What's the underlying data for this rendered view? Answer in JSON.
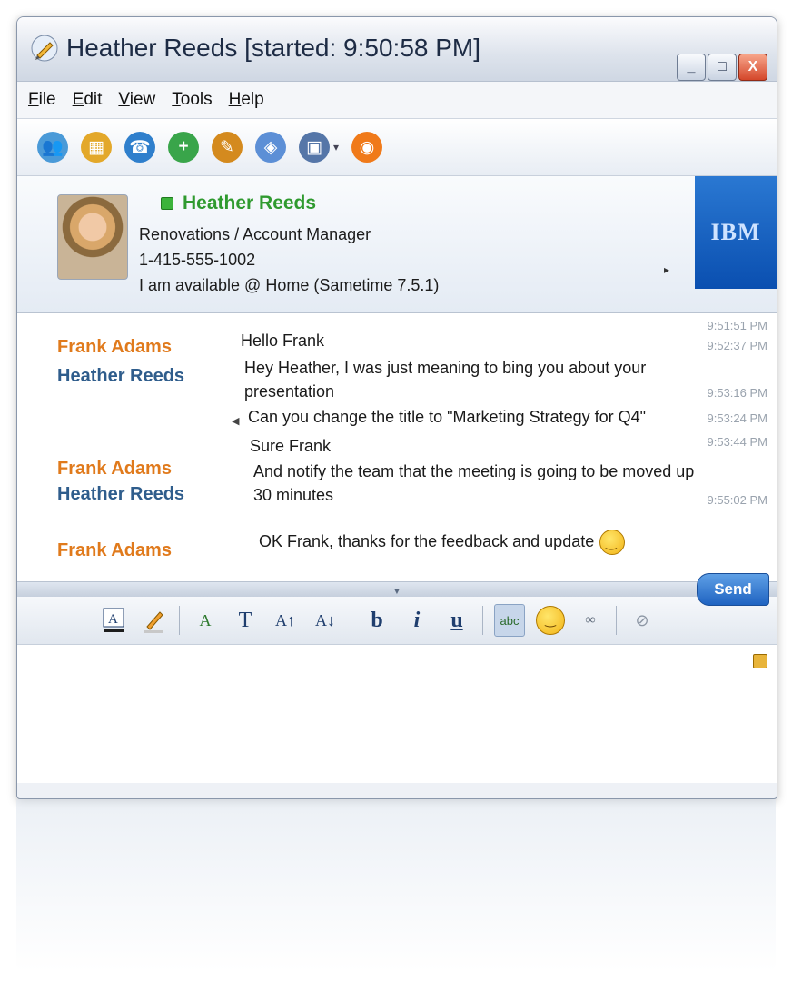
{
  "window": {
    "title": "Heather Reeds [started: 9:50:58 PM]",
    "min_label": "_",
    "max_label": "□",
    "close_label": "X"
  },
  "menu": [
    "File",
    "Edit",
    "View",
    "Tools",
    "Help"
  ],
  "toolbar": {
    "icons": [
      "contacts-icon",
      "meeting-icon",
      "call-icon",
      "add-person-icon",
      "share-icon",
      "whiteboard-icon",
      "screen-share-icon",
      "record-icon"
    ]
  },
  "contact": {
    "name": "Heather Reeds",
    "title": "Renovations / Account Manager",
    "phone": "1-415-555-1002",
    "status": "I am available @ Home (Sametime 7.5.1)",
    "brand": "IBM"
  },
  "transcript": [
    {
      "sender": "Frank Adams",
      "sender_color": "frank",
      "text": "Hello Frank",
      "time": "9:51:51 PM"
    },
    {
      "sender": "Heather Reeds",
      "sender_color": "heather",
      "text": "Hey Heather, I was just meaning to bing you about your",
      "time": "9:52:37 PM"
    },
    {
      "sender": "",
      "sender_color": "heather",
      "text": "presentation",
      "time": ""
    },
    {
      "sender": "",
      "sender_color": "heather",
      "text": "Can you change the title to \"Marketing Strategy for Q4\"",
      "time": "9:53:16 PM"
    },
    {
      "sender": "",
      "sender_color": "heather",
      "text": "",
      "time": "9:53:24 PM"
    },
    {
      "sender": "Frank Adams",
      "sender_color": "frank",
      "text": "Sure Frank",
      "time": ""
    },
    {
      "sender": "Heather Reeds",
      "sender_color": "heather",
      "text": "And notify the team that the meeting is going to be moved up",
      "time": "9:53:44 PM"
    },
    {
      "sender": "",
      "sender_color": "heather",
      "text": "30 minutes",
      "time": "9:55:02 PM"
    },
    {
      "sender": "Frank Adams",
      "sender_color": "frank",
      "text": "OK Frank, thanks for the feedback and update",
      "time": ""
    }
  ],
  "format_bar": {
    "text_size_label": "T",
    "bold_label": "b",
    "italic_label": "i",
    "underline_label": "u",
    "spell_label": "abc",
    "send_label": "Send"
  },
  "colors": {
    "frank": "#e07a1c",
    "heather": "#2f5d8c",
    "online": "#2f9a2f",
    "brand_blue": "#0a4fb0"
  }
}
